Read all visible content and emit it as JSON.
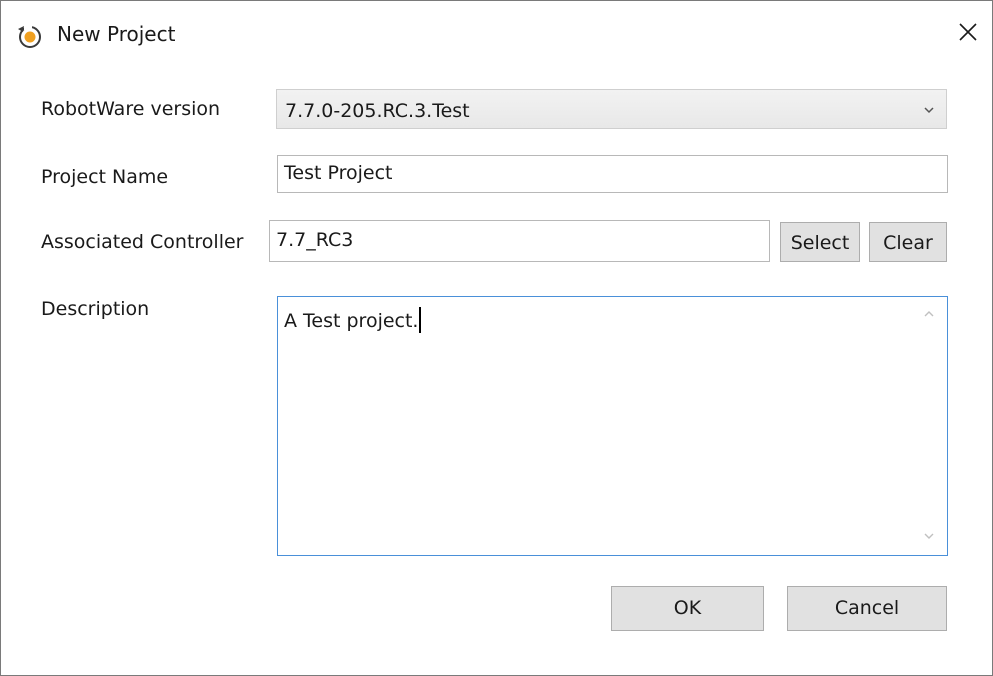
{
  "window": {
    "title": "New Project",
    "app_icon": "rotate-arrow-icon",
    "close_icon": "close-icon"
  },
  "form": {
    "robotware": {
      "label": "RobotWare version",
      "value": "7.7.0-205.RC.3.Test",
      "chevron_icon": "chevron-down-icon"
    },
    "project_name": {
      "label": "Project Name",
      "value": "Test Project"
    },
    "controller": {
      "label": "Associated Controller",
      "value": "7.7_RC3",
      "select_label": "Select",
      "clear_label": "Clear"
    },
    "description": {
      "label": "Description",
      "value": "A Test project."
    }
  },
  "footer": {
    "ok_label": "OK",
    "cancel_label": "Cancel"
  },
  "colors": {
    "accent_border": "#4a90d9",
    "button_bg": "#e1e1e1",
    "icon_orange": "#f0a020"
  }
}
